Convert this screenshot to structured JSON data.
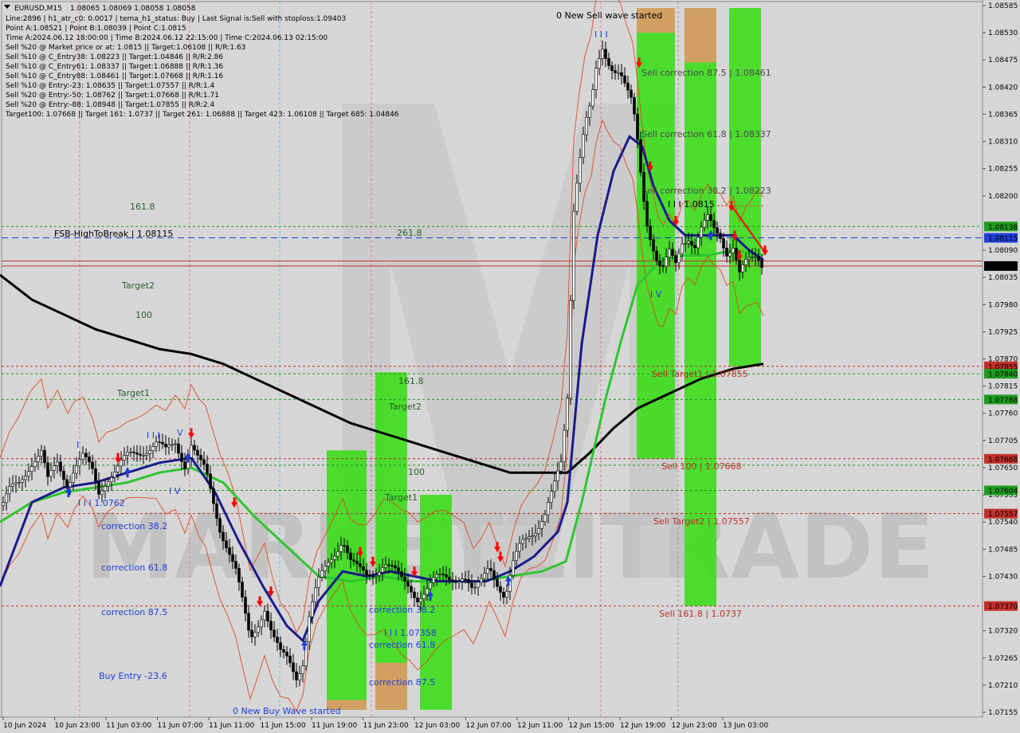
{
  "symbol_header": "EURUSD,M15",
  "ohlc_header": "1.08065 1.08069 1.08058 1.08058",
  "info_lines": [
    "Line:2896 | h1_atr_c0: 0.0017 | tema_h1_status: Buy | Last Signal is:Sell with stoploss:1.09403",
    "Point A:1.08521 | Point B:1.08039 | Point C:1.0815",
    "Time A:2024.06.12 18:00:00 | Time B:2024.06.12 22:15:00 | Time C:2024.06.13 02:15:00",
    "Sell %20 @ Market price or at: 1.0815 || Target:1.06108 || R/R:1.63",
    "Sell %10 @ C_Entry38: 1.08223 || Target:1.04846 || R/R:2.86",
    "Sell %10 @ C_Entry61: 1.08337 || Target:1.06888 || R/R:1.36",
    "Sell %10 @ C_Entry88: 1.08461 || Target:1.07668 || R/R:1.16",
    "Sell %10 @ Entry:-23: 1.08635 || Target:1.07557 || R/R:1.4",
    "Sell %20 @ Entry:-50: 1.08762 || Target:1.07668 || R/R:1.71",
    "Sell %20 @ Entry:-88: 1.08948 || Target:1.07855 || R/R:2.4",
    "Target100: 1.07668 || Target 161: 1.0737 || Target 261: 1.06888 || Target 423: 1.06108 || Target 685: 1.04846"
  ],
  "price_ticks": [
    "1.08585",
    "1.08530",
    "1.08475",
    "1.08420",
    "1.08365",
    "1.08310",
    "1.08255",
    "1.08200",
    "1.08090",
    "1.08035",
    "1.07980",
    "1.07925",
    "1.07870",
    "1.07815",
    "1.07760",
    "1.07705",
    "1.07650",
    "1.07595",
    "1.07540",
    "1.07485",
    "1.07430",
    "1.07320",
    "1.07265",
    "1.07210",
    "1.07155"
  ],
  "time_ticks": [
    "10 Jun 2024",
    "10 Jun 23:00",
    "11 Jun 03:00",
    "11 Jun 07:00",
    "11 Jun 11:00",
    "11 Jun 15:00",
    "11 Jun 19:00",
    "11 Jun 23:00",
    "12 Jun 03:00",
    "12 Jun 07:00",
    "12 Jun 11:00",
    "12 Jun 15:00",
    "12 Jun 19:00",
    "12 Jun 23:00",
    "13 Jun 03:00"
  ],
  "price_badges": [
    {
      "label": "1.08138",
      "color": "#1f9c1f"
    },
    {
      "label": "1.08115",
      "color": "#1f3fd6"
    },
    {
      "label": "1.08058",
      "color": "#000000"
    },
    {
      "label": "1.07855",
      "color": "#c0302b"
    },
    {
      "label": "1.07840",
      "color": "#1f9c1f"
    },
    {
      "label": "1.07788",
      "color": "#1f9c1f"
    },
    {
      "label": "1.07668",
      "color": "#c0302b"
    },
    {
      "label": "1.07604",
      "color": "#1f9c1f"
    },
    {
      "label": "1.07557",
      "color": "#c0302b"
    },
    {
      "label": "1.07370",
      "color": "#c0302b"
    }
  ],
  "annotations": {
    "new_sell_wave": "0 New Sell wave started",
    "new_buy_wave": "0 New Buy Wave started",
    "fsb_high": "FSB-HighToBreak | 1.08115",
    "fib_261": "261.8",
    "fib_161_left": "161.8",
    "target2_left": "Target2",
    "fib_100_left": "100",
    "target1_left": "Target1",
    "fib_161_mid": "161.8",
    "target2_mid": "Target2",
    "fib_100_mid": "100",
    "target1_mid": "Target1",
    "wave_label_left": "I I I 1.0762",
    "wave_label_mid": "I I I 1.07358",
    "wave_label_right": "I I I 1.0815",
    "correction_382_left": "correction 38.2",
    "correction_618_left": "correction 61.8",
    "correction_875_left": "correction 87.5",
    "buy_entry": "Buy Entry -23.6",
    "correction_382_mid": "correction 38.2",
    "correction_618_mid": "correction 61.8",
    "correction_875_mid": "correction 87.5",
    "sell_corr_875": "Sell correction 87.5 | 1.08461",
    "sell_corr_618": "Sell correction 61.8 | 1.08337",
    "sell_corr_382": "Sell correction 38.2 | 1.08223",
    "sell_target1": "Sell Target1 | 1.07855",
    "sell_100": "Sell 100 | 1.07668",
    "sell_target2": "Sell Target2 | 1.07557",
    "sell_161": "Sell 161.8 | 1.0737",
    "wave_I": "I",
    "wave_III": "I I I",
    "wave_V": "V",
    "wave_IV": "I V",
    "wave_III_top": "I I I",
    "wave_IV_right": "I V"
  },
  "watermark": "MARKETZITRADE",
  "colors": {
    "background": "#d6d6d6",
    "candle": "#000000",
    "ema_fast": "#1a1a8c",
    "ema_mid": "#2fc52f",
    "ema_slow": "#000000",
    "envelope": "#e0441a",
    "zone_green": "#3fdc1f",
    "zone_orange": "#e9946a",
    "fsb_line": "#1f3fd6",
    "price_line": "#c0302b",
    "sell_arrow": "#ff0000",
    "buy_arrow": "#1f3fd6"
  },
  "chart_data": {
    "type": "candlestick",
    "symbol": "EURUSD",
    "timeframe": "M15",
    "ylim": [
      1.07155,
      1.08585
    ],
    "current_price": 1.08058,
    "levels": {
      "fsb_high_to_break": 1.08115,
      "level_1_08138": 1.08138,
      "sell_target1": 1.07855,
      "level_1_07840": 1.0784,
      "level_1_07788": 1.07788,
      "sell_100": 1.07668,
      "level_1_07604": 1.07604,
      "sell_target2": 1.07557,
      "sell_161_8": 1.0737,
      "sell_correction_38_2": 1.08223,
      "sell_correction_61_8": 1.08337,
      "sell_correction_87_5": 1.08461
    },
    "price_path": [
      [
        0,
        1.0756
      ],
      [
        12,
        1.076
      ],
      [
        24,
        1.0762
      ],
      [
        38,
        1.0766
      ],
      [
        52,
        1.0768
      ],
      [
        60,
        1.0762
      ],
      [
        72,
        1.0766
      ],
      [
        85,
        1.0762
      ],
      [
        93,
        1.0765
      ],
      [
        104,
        1.0767
      ],
      [
        116,
        1.0764
      ],
      [
        124,
        1.076
      ],
      [
        134,
        1.0763
      ],
      [
        148,
        1.0765
      ],
      [
        160,
        1.0767
      ],
      [
        172,
        1.0768
      ],
      [
        184,
        1.0769
      ],
      [
        196,
        1.077
      ],
      [
        208,
        1.0768
      ],
      [
        220,
        1.077
      ],
      [
        232,
        1.0766
      ],
      [
        240,
        1.077
      ],
      [
        250,
        1.0766
      ],
      [
        258,
        1.0764
      ],
      [
        266,
        1.0759
      ],
      [
        276,
        1.0753
      ],
      [
        286,
        1.0749
      ],
      [
        296,
        1.0744
      ],
      [
        306,
        1.0736
      ],
      [
        314,
        1.073
      ],
      [
        322,
        1.0733
      ],
      [
        332,
        1.0737
      ],
      [
        342,
        1.0731
      ],
      [
        352,
        1.0727
      ],
      [
        362,
        1.0726
      ],
      [
        372,
        1.0723
      ],
      [
        380,
        1.0726
      ],
      [
        388,
        1.0735
      ],
      [
        398,
        1.0741
      ],
      [
        410,
        1.0745
      ],
      [
        420,
        1.0748
      ],
      [
        430,
        1.0751
      ],
      [
        440,
        1.0746
      ],
      [
        450,
        1.0744
      ],
      [
        460,
        1.0743
      ],
      [
        470,
        1.0744
      ],
      [
        482,
        1.0746
      ],
      [
        494,
        1.0744
      ],
      [
        504,
        1.0742
      ],
      [
        514,
        1.0741
      ],
      [
        524,
        1.0739
      ],
      [
        534,
        1.074
      ],
      [
        546,
        1.0742
      ],
      [
        558,
        1.0743
      ],
      [
        570,
        1.0743
      ],
      [
        582,
        1.0743
      ],
      [
        594,
        1.0739
      ],
      [
        604,
        1.0742
      ],
      [
        614,
        1.0746
      ],
      [
        624,
        1.0742
      ],
      [
        634,
        1.0738
      ],
      [
        644,
        1.0745
      ],
      [
        654,
        1.075
      ],
      [
        664,
        1.0752
      ],
      [
        674,
        1.0753
      ],
      [
        684,
        1.0755
      ],
      [
        694,
        1.076
      ],
      [
        704,
        1.0766
      ],
      [
        712,
        1.078
      ],
      [
        716,
        1.08
      ],
      [
        720,
        1.0818
      ],
      [
        726,
        1.0826
      ],
      [
        734,
        1.0834
      ],
      [
        742,
        1.0838
      ],
      [
        748,
        1.0845
      ],
      [
        756,
        1.085
      ],
      [
        762,
        1.0848
      ],
      [
        770,
        1.0846
      ],
      [
        778,
        1.0845
      ],
      [
        786,
        1.0841
      ],
      [
        794,
        1.0838
      ],
      [
        800,
        1.0831
      ],
      [
        806,
        1.0822
      ],
      [
        812,
        1.0815
      ],
      [
        818,
        1.0811
      ],
      [
        826,
        1.0806
      ],
      [
        832,
        1.0805
      ],
      [
        840,
        1.0808
      ],
      [
        848,
        1.0806
      ],
      [
        856,
        1.0811
      ],
      [
        864,
        1.0812
      ],
      [
        872,
        1.081
      ],
      [
        880,
        1.0813
      ],
      [
        888,
        1.0815
      ],
      [
        896,
        1.0813
      ],
      [
        904,
        1.0812
      ],
      [
        912,
        1.0809
      ],
      [
        920,
        1.081
      ],
      [
        928,
        1.0804
      ],
      [
        936,
        1.0806
      ],
      [
        944,
        1.0807
      ],
      [
        950,
        1.0808
      ],
      [
        958,
        1.0806
      ]
    ],
    "ema_fast": [
      [
        0,
        1.0741
      ],
      [
        40,
        1.0758
      ],
      [
        80,
        1.0761
      ],
      [
        120,
        1.0762
      ],
      [
        160,
        1.0764
      ],
      [
        200,
        1.0766
      ],
      [
        240,
        1.0767
      ],
      [
        270,
        1.076
      ],
      [
        300,
        1.075
      ],
      [
        330,
        1.0741
      ],
      [
        360,
        1.0733
      ],
      [
        380,
        1.073
      ],
      [
        400,
        1.0738
      ],
      [
        430,
        1.0744
      ],
      [
        460,
        1.0743
      ],
      [
        490,
        1.0744
      ],
      [
        520,
        1.0743
      ],
      [
        550,
        1.0742
      ],
      [
        580,
        1.0742
      ],
      [
        610,
        1.0742
      ],
      [
        640,
        1.0744
      ],
      [
        670,
        1.0747
      ],
      [
        700,
        1.0752
      ],
      [
        712,
        1.0758
      ],
      [
        730,
        1.079
      ],
      [
        750,
        1.0812
      ],
      [
        770,
        1.0825
      ],
      [
        790,
        1.0832
      ],
      [
        806,
        1.083
      ],
      [
        820,
        1.0822
      ],
      [
        840,
        1.0815
      ],
      [
        860,
        1.0812
      ],
      [
        880,
        1.0812
      ],
      [
        900,
        1.0812
      ],
      [
        920,
        1.0812
      ],
      [
        940,
        1.0809
      ],
      [
        958,
        1.0807
      ]
    ],
    "ema_mid": [
      [
        0,
        1.0754
      ],
      [
        40,
        1.0758
      ],
      [
        80,
        1.076
      ],
      [
        120,
        1.0761
      ],
      [
        160,
        1.0762
      ],
      [
        200,
        1.0764
      ],
      [
        240,
        1.0765
      ],
      [
        280,
        1.0762
      ],
      [
        320,
        1.0755
      ],
      [
        360,
        1.0749
      ],
      [
        400,
        1.0743
      ],
      [
        440,
        1.0742
      ],
      [
        480,
        1.0743
      ],
      [
        520,
        1.0742
      ],
      [
        560,
        1.0742
      ],
      [
        600,
        1.0742
      ],
      [
        640,
        1.0743
      ],
      [
        680,
        1.0744
      ],
      [
        710,
        1.0746
      ],
      [
        730,
        1.0758
      ],
      [
        760,
        1.0779
      ],
      [
        780,
        1.0791
      ],
      [
        800,
        1.0802
      ],
      [
        830,
        1.0807
      ],
      [
        860,
        1.0808
      ],
      [
        890,
        1.0808
      ],
      [
        920,
        1.0809
      ],
      [
        958,
        1.0808
      ]
    ],
    "ema_slow": [
      [
        0,
        1.0804
      ],
      [
        40,
        1.0799
      ],
      [
        80,
        1.0796
      ],
      [
        120,
        1.0793
      ],
      [
        160,
        1.0791
      ],
      [
        200,
        1.0789
      ],
      [
        240,
        1.0788
      ],
      [
        280,
        1.0786
      ],
      [
        320,
        1.0783
      ],
      [
        360,
        1.078
      ],
      [
        400,
        1.0777
      ],
      [
        440,
        1.0774
      ],
      [
        480,
        1.0772
      ],
      [
        520,
        1.077
      ],
      [
        560,
        1.0768
      ],
      [
        600,
        1.0766
      ],
      [
        640,
        1.0764
      ],
      [
        680,
        1.0764
      ],
      [
        712,
        1.0764
      ],
      [
        740,
        1.0768
      ],
      [
        770,
        1.0773
      ],
      [
        800,
        1.0777
      ],
      [
        840,
        1.078
      ],
      [
        880,
        1.0783
      ],
      [
        920,
        1.0785
      ],
      [
        958,
        1.0786
      ]
    ],
    "zones": [
      {
        "x0": 410,
        "x1": 460,
        "top": 1.07685,
        "bottom": 1.0716,
        "color": "green"
      },
      {
        "x0": 410,
        "x1": 460,
        "top": 1.0718,
        "bottom": 1.0716,
        "color": "orange"
      },
      {
        "x0": 471,
        "x1": 511,
        "top": 1.07843,
        "bottom": 1.0716,
        "color": "green"
      },
      {
        "x0": 471,
        "x1": 511,
        "top": 1.07255,
        "bottom": 1.0716,
        "color": "orange"
      },
      {
        "x0": 527,
        "x1": 567,
        "top": 1.07595,
        "bottom": 1.0716,
        "color": "green"
      },
      {
        "x0": 799,
        "x1": 847,
        "top": 1.0858,
        "bottom": 1.07668,
        "color": "green"
      },
      {
        "x0": 799,
        "x1": 847,
        "top": 1.0858,
        "bottom": 1.0853,
        "color": "orange"
      },
      {
        "x0": 859,
        "x1": 899,
        "top": 1.0858,
        "bottom": 1.0737,
        "color": "green"
      },
      {
        "x0": 859,
        "x1": 899,
        "top": 1.0858,
        "bottom": 1.0847,
        "color": "orange"
      },
      {
        "x0": 915,
        "x1": 955,
        "top": 1.0858,
        "bottom": 1.07855,
        "color": "green"
      }
    ],
    "sell_arrows": [
      [
        148,
        1.0767
      ],
      [
        240,
        1.0772
      ],
      [
        294,
        1.0758
      ],
      [
        326,
        1.0738
      ],
      [
        340,
        1.074
      ],
      [
        452,
        1.0748
      ],
      [
        468,
        1.0746
      ],
      [
        520,
        1.0744
      ],
      [
        624,
        1.0749
      ],
      [
        628,
        1.0747
      ],
      [
        802,
        1.0847
      ],
      [
        816,
        1.0826
      ],
      [
        848,
        1.0815
      ],
      [
        918,
        1.0818
      ],
      [
        922,
        1.0812
      ],
      [
        928,
        1.0808
      ],
      [
        960,
        1.0809
      ]
    ],
    "buy_arrows": [
      [
        86,
        1.076
      ],
      [
        160,
        1.0764
      ],
      [
        236,
        1.0767
      ],
      [
        382,
        1.0729
      ],
      [
        540,
        1.0739
      ],
      [
        638,
        1.0742
      ],
      [
        892,
        1.0812
      ]
    ],
    "vlines": [
      {
        "x": 100,
        "style": "pink"
      },
      {
        "x": 238,
        "style": "pink"
      },
      {
        "x": 351,
        "style": "cyan"
      },
      {
        "x": 466,
        "style": "pink"
      },
      {
        "x": 754,
        "style": "pink"
      },
      {
        "x": 851,
        "style": "gray"
      }
    ]
  }
}
